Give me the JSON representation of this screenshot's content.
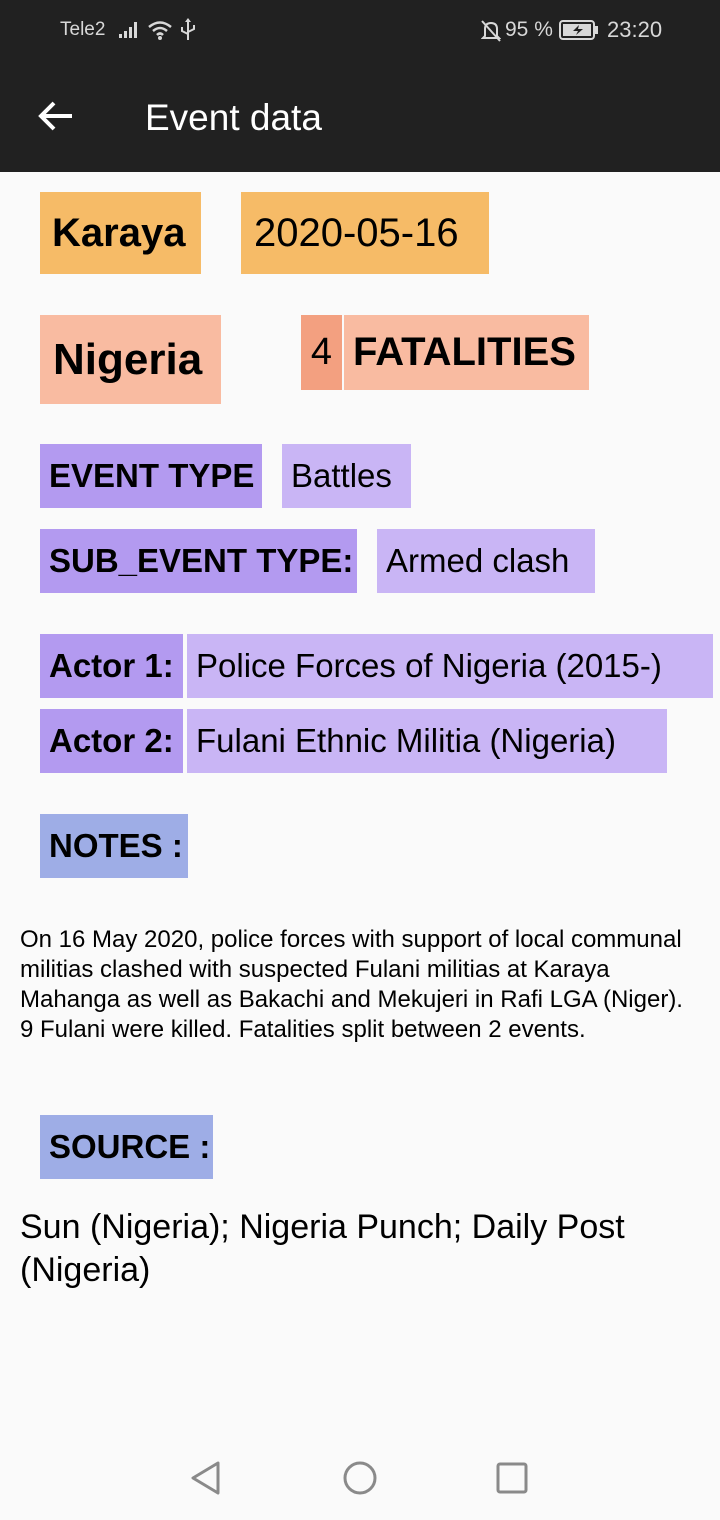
{
  "status_bar": {
    "carrier": "Tele2",
    "battery": "95 %",
    "time": "23:20",
    "icons": [
      "signal-icon",
      "wifi-icon",
      "usb-icon",
      "bell-off-icon",
      "battery-charging-icon"
    ]
  },
  "app_bar": {
    "title": "Event data",
    "back_icon": "arrow-left-icon"
  },
  "event": {
    "location": "Karaya",
    "date": "2020-05-16",
    "country": "Nigeria",
    "fatalities_count": "4",
    "fatalities_label": "FATALITIES",
    "event_type_label": "EVENT TYPE",
    "event_type": "Battles",
    "sub_event_type_label": "SUB_EVENT TYPE:",
    "sub_event_type": "Armed clash",
    "actor1_label": "Actor 1:",
    "actor1": "Police Forces of Nigeria (2015-)",
    "actor2_label": "Actor 2:",
    "actor2": "Fulani Ethnic Militia (Nigeria)",
    "notes_label": "NOTES :",
    "notes": "On 16 May 2020, police forces with support of local communal militias clashed with suspected Fulani militias at Karaya Mahanga as well as Bakachi and Mekujeri in Rafi LGA (Niger). 9 Fulani were killed. Fatalities split between 2 events.",
    "source_label": "SOURCE :",
    "source": "Sun (Nigeria); Nigeria Punch; Daily Post (Nigeria)"
  },
  "colors": {
    "bar": "#212121",
    "location_date": "#f6bb67",
    "country_fatalities": "#f9bba1",
    "fatalities_count": "#f3a080",
    "label_purple": "#b39af0",
    "value_purple": "#c9b5f5",
    "section_blue": "#9eade6"
  },
  "nav_bar": {
    "icons": [
      "back-triangle-icon",
      "home-circle-icon",
      "recents-square-icon"
    ]
  }
}
